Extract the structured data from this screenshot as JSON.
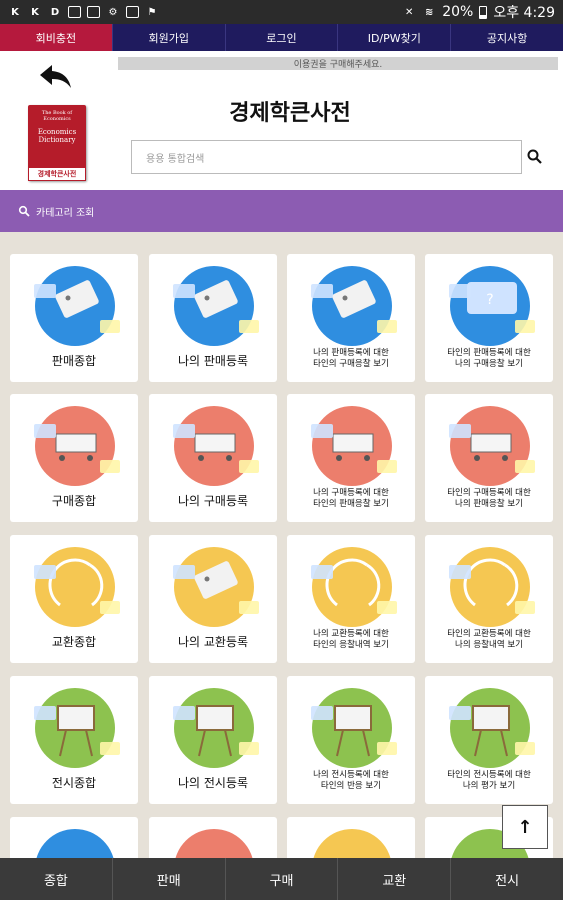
{
  "status_bar": {
    "battery": "20%",
    "time": "오후 4:29",
    "left_icons": [
      "k-icon",
      "k-icon",
      "d-icon",
      "image-icon",
      "image-icon",
      "settings-icon",
      "photo-icon",
      "flag-icon"
    ]
  },
  "top_nav": {
    "items": [
      {
        "label": "회비충전",
        "active": true
      },
      {
        "label": "회원가입",
        "active": false
      },
      {
        "label": "로그인",
        "active": false
      },
      {
        "label": "ID/PW찾기",
        "active": false
      },
      {
        "label": "공지사항",
        "active": false
      }
    ]
  },
  "header": {
    "notice": "이용권을 구매해주세요.",
    "title": "경제학큰사전",
    "book": {
      "line1": "The Book of Economics",
      "line2": "Economics Dictionary",
      "line3": "경제학큰사전"
    },
    "search_placeholder": "용용 통합검색"
  },
  "category_bar": {
    "label": "카테고리 조회"
  },
  "cards": [
    {
      "label": "판매종합",
      "small": false,
      "color": "#2f8ee0",
      "icon": "tag-icon"
    },
    {
      "label": "나의 판매등록",
      "small": false,
      "color": "#2f8ee0",
      "icon": "sell-tag-icon"
    },
    {
      "label": "나의 판매등록에 대한\n타인의 구매응찰 보기",
      "small": true,
      "color": "#2f8ee0",
      "icon": "question-tag-icon"
    },
    {
      "label": "타인의 판매등록에 대한\n나의 구매응찰 보기",
      "small": true,
      "color": "#2f8ee0",
      "icon": "question-bubble-icon"
    },
    {
      "label": "구매종합",
      "small": false,
      "color": "#ec7e6c",
      "icon": "cart-icon"
    },
    {
      "label": "나의 구매등록",
      "small": false,
      "color": "#ec7e6c",
      "icon": "buy-cart-icon"
    },
    {
      "label": "나의 구매등록에 대한\n타인의 판매응찰 보기",
      "small": true,
      "color": "#ec7e6c",
      "icon": "question-cart-icon"
    },
    {
      "label": "타인의 구매등록에 대한\n나의 판매응찰 보기",
      "small": true,
      "color": "#ec7e6c",
      "icon": "question-cart-bubble-icon"
    },
    {
      "label": "교환종합",
      "small": false,
      "color": "#f5c752",
      "icon": "exchange-icon"
    },
    {
      "label": "나의 교환등록",
      "small": false,
      "color": "#f5c752",
      "icon": "exchange-tag-icon"
    },
    {
      "label": "나의 교환등록에 대한\n타인의 응찰내역 보기",
      "small": true,
      "color": "#f5c752",
      "icon": "question-exchange-icon"
    },
    {
      "label": "타인의 교환등록에 대한\n나의 응찰내역 보기",
      "small": true,
      "color": "#f5c752",
      "icon": "sell-buy-icon"
    },
    {
      "label": "전시종합",
      "small": false,
      "color": "#8dc24f",
      "icon": "easel-icon"
    },
    {
      "label": "나의 전시등록",
      "small": false,
      "color": "#8dc24f",
      "icon": "exhibition-easel-icon"
    },
    {
      "label": "나의 전시등록에 대한\n타인의 반응 보기",
      "small": true,
      "color": "#8dc24f",
      "icon": "question-easel-icon"
    },
    {
      "label": "타인의 전시등록에 대한\n나의 평가 보기",
      "small": true,
      "color": "#8dc24f",
      "icon": "star-easel-icon"
    },
    {
      "label": "",
      "small": false,
      "color": "#2f8ee0",
      "icon": "circle-icon"
    },
    {
      "label": "",
      "small": false,
      "color": "#ec7e6c",
      "icon": "circle-icon"
    },
    {
      "label": "",
      "small": false,
      "color": "#f5c752",
      "icon": "circle-icon"
    },
    {
      "label": "",
      "small": false,
      "color": "#8dc24f",
      "icon": "circle-icon"
    }
  ],
  "scroll_top": {
    "label": "↑"
  },
  "bottom_nav": {
    "items": [
      "종합",
      "판매",
      "구매",
      "교환",
      "전시"
    ]
  }
}
